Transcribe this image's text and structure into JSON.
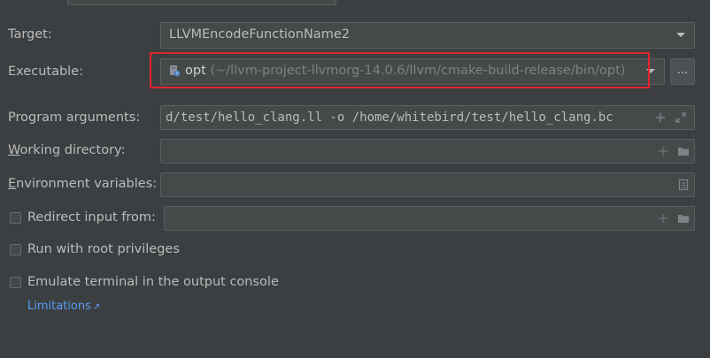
{
  "form": {
    "target": {
      "label": "Target:",
      "value": "LLVMEncodeFunctionName2"
    },
    "executable": {
      "label": "Executable:",
      "name": "opt",
      "path": " (~/llvm-project-llvmorg-14.0.6/llvm/cmake-build-release/bin/opt)",
      "browse_label": "..."
    },
    "program_arguments": {
      "label": "Program arguments:",
      "value": "d/test/hello_clang.ll -o /home/whitebird/test/hello_clang.bc"
    },
    "working_directory": {
      "label_mnemonic": "W",
      "label_rest": "orking directory:",
      "value": ""
    },
    "environment_variables": {
      "label_mnemonic": "E",
      "label_rest": "nvironment variables:",
      "value": ""
    },
    "redirect_input": {
      "label": "Redirect input from:",
      "checked": false,
      "value": ""
    },
    "root_privileges": {
      "label": "Run with root privileges",
      "checked": false
    },
    "emulate_terminal": {
      "label": "Emulate terminal in the output console",
      "checked": false
    },
    "limitations_link": "Limitations",
    "limitations_arrow": "↗"
  },
  "icons": {
    "plus": "plus-icon",
    "folder": "folder-icon",
    "expand": "expand-icon",
    "env_edit": "document-icon",
    "executable": "executable-file-icon"
  },
  "colors": {
    "background": "#3c3f41",
    "field_bg": "#45494a",
    "text": "#bbbbbb",
    "highlight": "#e0252f",
    "link": "#589df6"
  }
}
